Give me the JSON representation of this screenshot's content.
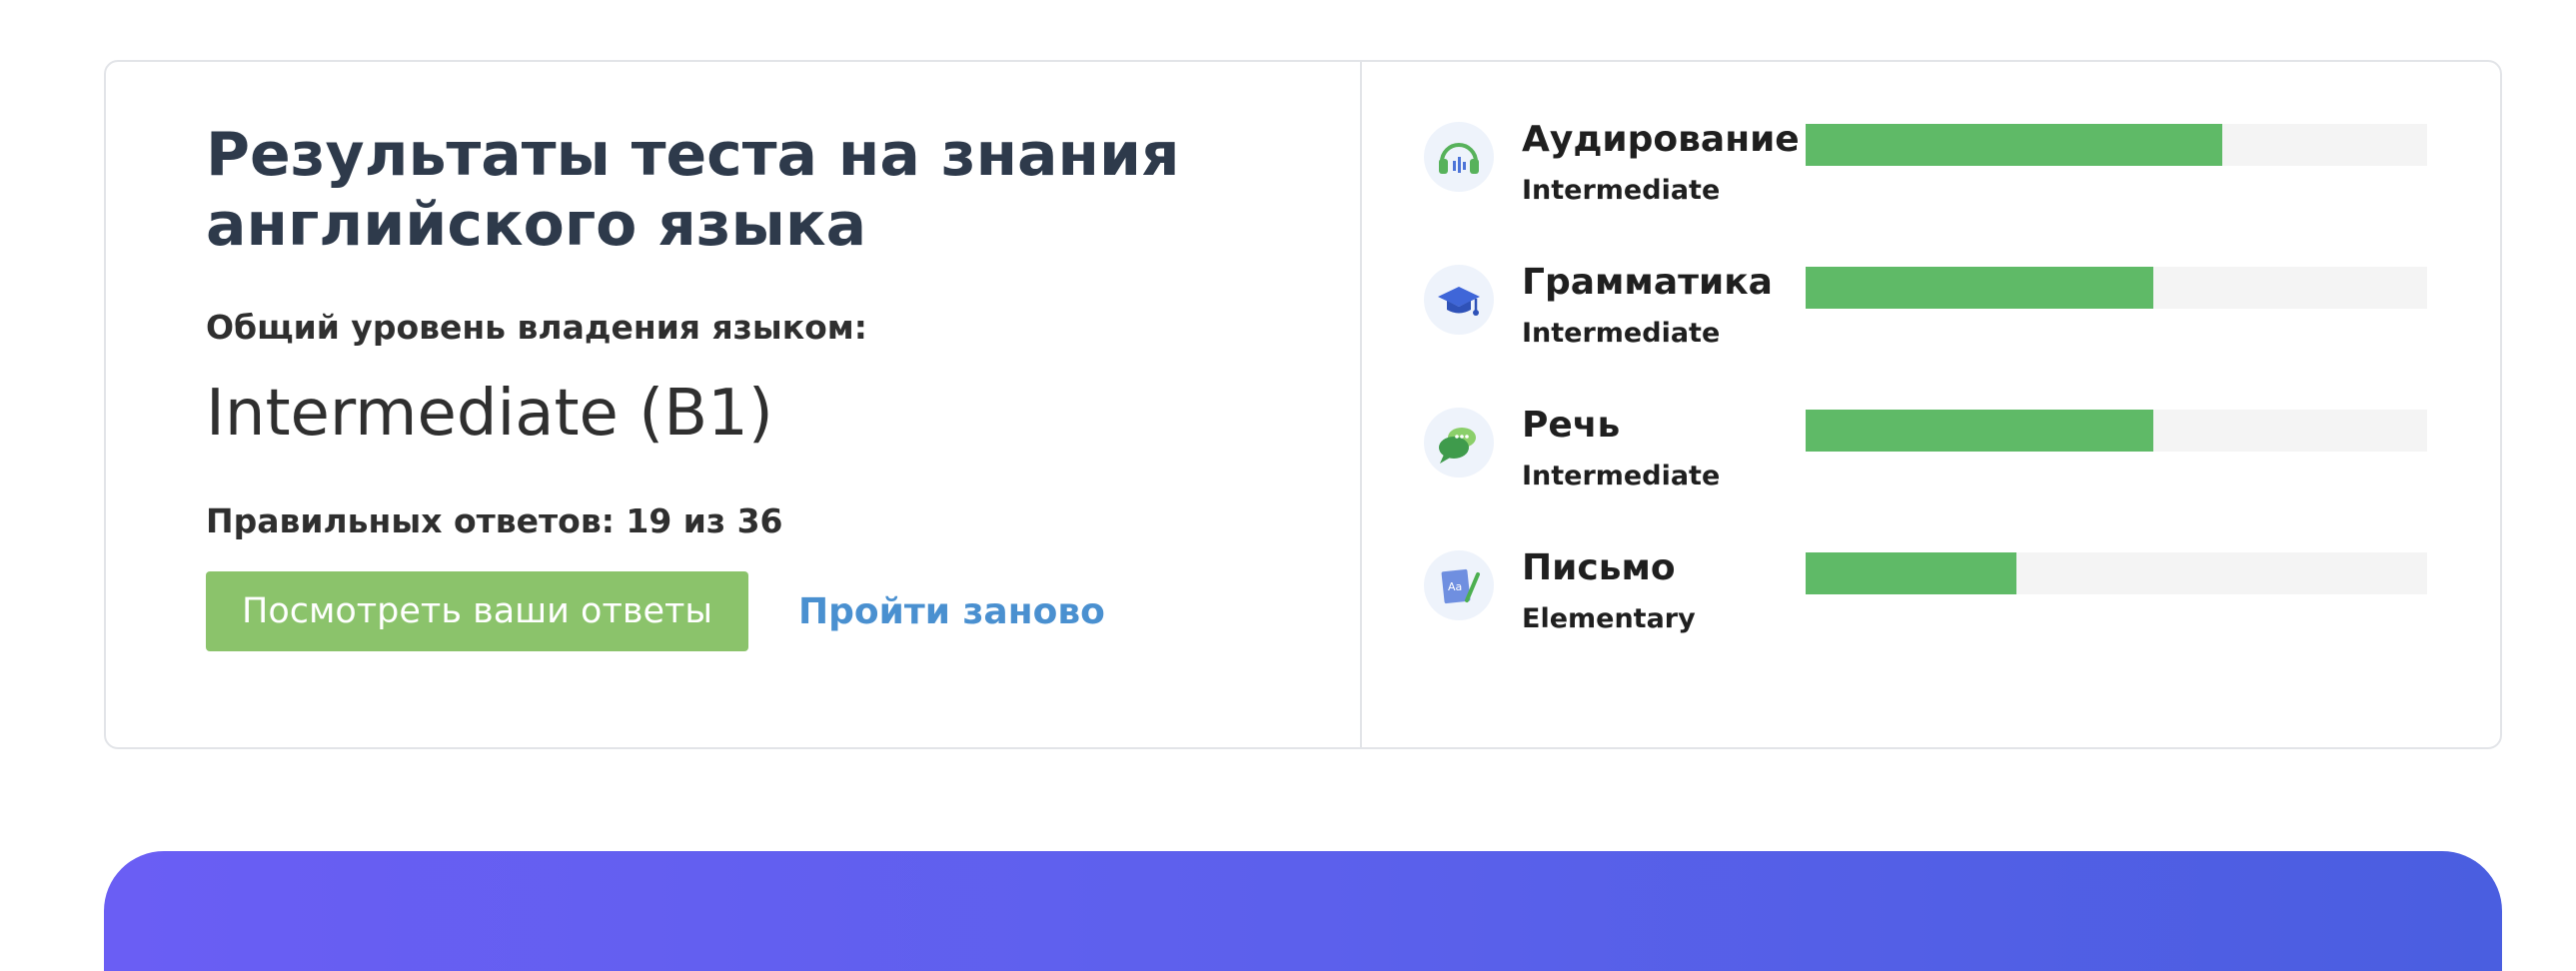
{
  "results": {
    "title": "Результаты теста на знания английского языка",
    "overall_label": "Общий уровень владения языком:",
    "overall_value": "Intermediate (B1)",
    "score_text": "Правильных ответов: 19 из 36",
    "view_answers_label": "Посмотреть ваши ответы",
    "retake_label": "Пройти заново"
  },
  "colors": {
    "bar_fill": "#5fba67",
    "bar_track": "#f4f4f4",
    "primary_button": "#8bc36b",
    "link": "#4a90d0",
    "banner": "#5c60ec"
  },
  "skills": [
    {
      "name": "Аудирование",
      "level": "Intermediate",
      "icon": "headphones-icon",
      "progress": 0.67
    },
    {
      "name": "Грамматика",
      "level": "Intermediate",
      "icon": "graduation-cap-icon",
      "progress": 0.56
    },
    {
      "name": "Речь",
      "level": "Intermediate",
      "icon": "speech-bubble-icon",
      "progress": 0.56
    },
    {
      "name": "Письмо",
      "level": "Elementary",
      "icon": "notebook-pencil-icon",
      "progress": 0.34
    }
  ]
}
